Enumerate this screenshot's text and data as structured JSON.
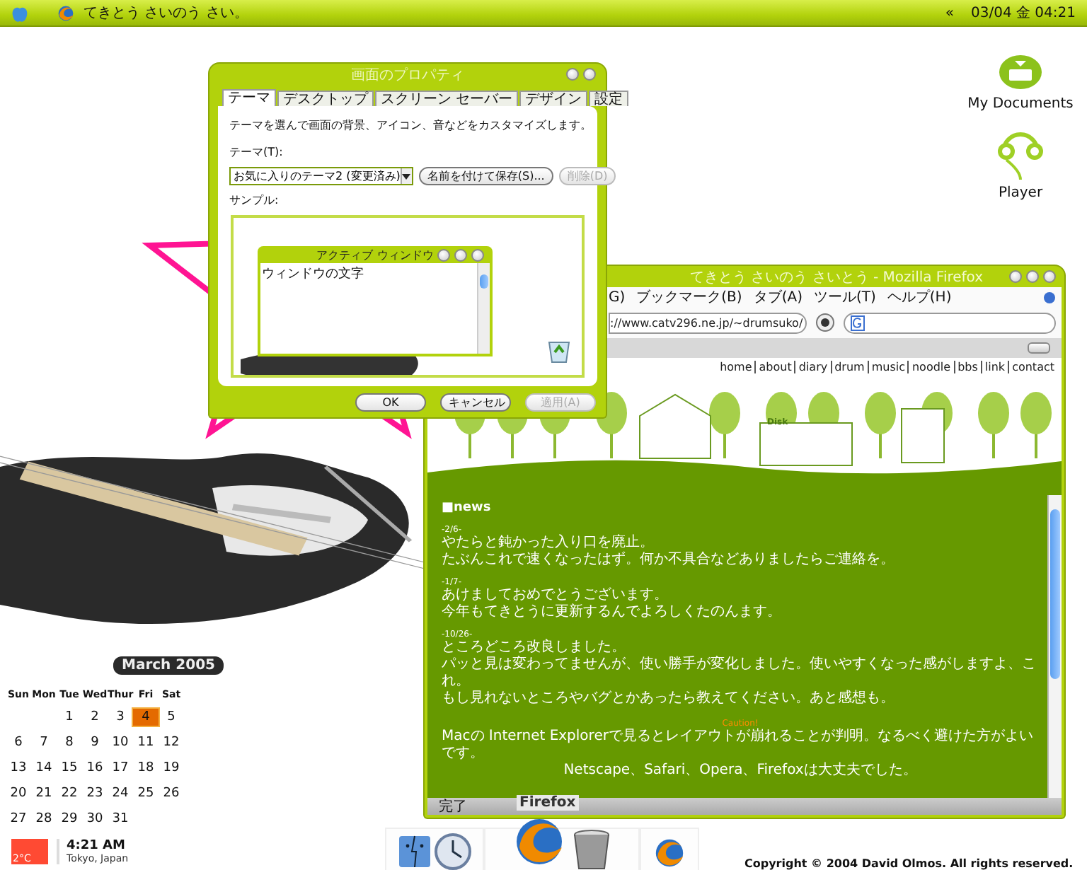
{
  "menu_bar": {
    "app_title": "てきとう さいのう さい。",
    "collapse": "«",
    "clock": "03/04 金 04:21"
  },
  "desktop_icons": [
    {
      "label": "My Documents",
      "kind": "drawer"
    },
    {
      "label": "Player",
      "kind": "headphones"
    }
  ],
  "display_dialog": {
    "title": "画面のプロパティ",
    "tabs": [
      {
        "label": "テーマ",
        "selected": true
      },
      {
        "label": "デスクトップ",
        "selected": false
      },
      {
        "label": "スクリーン セーバー",
        "selected": false
      },
      {
        "label": "デザイン",
        "selected": false
      },
      {
        "label": "設定",
        "selected": false
      }
    ],
    "description": "テーマを選んで画面の背景、アイコン、音などをカスタマイズします。",
    "theme_label": "テーマ(T):",
    "theme_value": "お気に入りのテーマ2 (変更済み)",
    "side_buttons": [
      {
        "label": "名前を付けて保存(S)...",
        "disabled": false
      },
      {
        "label": "削除(D)",
        "disabled": true
      }
    ],
    "sample_label": "サンプル:",
    "sample_window": {
      "title": "アクティブ ウィンドウ",
      "text": "ウィンドウの文字"
    },
    "buttons": [
      {
        "label": "OK",
        "disabled": false
      },
      {
        "label": "キャンセル",
        "disabled": false
      },
      {
        "label": "適用(A)",
        "disabled": true
      }
    ]
  },
  "browser": {
    "title": "てきとう さいのう さいとう - Mozilla Firefox",
    "menu": [
      "G)",
      "ブックマーク(B)",
      "タブ(A)",
      "ツール(T)",
      "ヘルプ(H)"
    ],
    "url": "://www.catv296.ne.jp/~drumsuko/",
    "site_nav": [
      "home",
      "about",
      "diary",
      "drum",
      "music",
      "noodle",
      "bbs",
      "link",
      "contact"
    ],
    "sign": "Disk",
    "news": {
      "heading": "■news",
      "entries": [
        {
          "date": "-2/6-",
          "lines": [
            "やたらと鈍かった入り口を廃止。",
            "たぶんこれで速くなったはず。何か不具合などありましたらご連絡を。"
          ]
        },
        {
          "date": "-1/7-",
          "lines": [
            "あけましておめでとうございます。",
            "今年もてきとうに更新するんでよろしくたのんます。"
          ]
        },
        {
          "date": "-10/26-",
          "lines": [
            "ところどころ改良しました。",
            "パッと見は変わってませんが、使い勝手が変化しました。使いやすくなった感がしますよ、これ。",
            "もし見れないところやバグとかあったら教えてください。あと感想も。"
          ]
        }
      ],
      "caution": {
        "label": "Caution!",
        "lines": [
          "Macの Internet Explorerで見るとレイアウトが崩れることが判明。なるべく避けた方がよいです。",
          "Netscape、Safari、Opera、Firefoxは大丈夫でした。"
        ]
      }
    },
    "status": "完了"
  },
  "calendar": {
    "title": "March 2005",
    "weekdays": [
      "Sun",
      "Mon",
      "Tue",
      "Wed",
      "Thur",
      "Fri",
      "Sat"
    ],
    "weeks": [
      [
        {
          "day": "1",
          "selected": false
        },
        {
          "day": "2",
          "selected": false
        },
        {
          "day": "3",
          "selected": false
        },
        {
          "day": "4",
          "selected": true
        },
        {
          "day": "5",
          "selected": false
        }
      ],
      [
        {
          "day": "6",
          "selected": false
        },
        {
          "day": "7",
          "selected": false
        },
        {
          "day": "8",
          "selected": false
        },
        {
          "day": "9",
          "selected": false
        },
        {
          "day": "10",
          "selected": false
        },
        {
          "day": "11",
          "selected": false
        },
        {
          "day": "12",
          "selected": false
        }
      ],
      [
        {
          "day": "13",
          "selected": false
        },
        {
          "day": "14",
          "selected": false
        },
        {
          "day": "15",
          "selected": false
        },
        {
          "day": "16",
          "selected": false
        },
        {
          "day": "17",
          "selected": false
        },
        {
          "day": "18",
          "selected": false
        },
        {
          "day": "19",
          "selected": false
        }
      ],
      [
        {
          "day": "20",
          "selected": false
        },
        {
          "day": "21",
          "selected": false
        },
        {
          "day": "22",
          "selected": false
        },
        {
          "day": "23",
          "selected": false
        },
        {
          "day": "24",
          "selected": false
        },
        {
          "day": "25",
          "selected": false
        },
        {
          "day": "26",
          "selected": false
        }
      ],
      [
        {
          "day": "27",
          "selected": false
        },
        {
          "day": "28",
          "selected": false
        },
        {
          "day": "29",
          "selected": false
        },
        {
          "day": "30",
          "selected": false
        },
        {
          "day": "31",
          "selected": false
        }
      ]
    ]
  },
  "weather": {
    "temperature": "2°C"
  },
  "world_clock": {
    "time": "4:21 AM",
    "place": "Tokyo, Japan"
  },
  "dock": {
    "label": "Firefox",
    "items": [
      {
        "kind": "finder"
      },
      {
        "kind": "clock"
      },
      {
        "kind": "firefox"
      },
      {
        "kind": "trash"
      },
      {
        "kind": "firefox-small"
      }
    ]
  },
  "copyright": "Copyright © 2004 David Olmos. All rights reserved."
}
